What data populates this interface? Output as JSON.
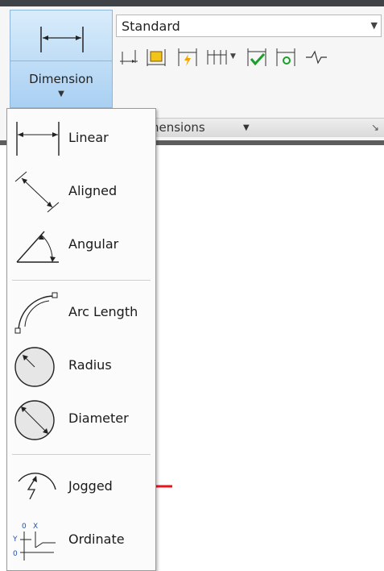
{
  "ribbon": {
    "big_button_label": "Dimension",
    "style_value": "Standard",
    "panel_title": "nensions",
    "tools": [
      "continue-dim-icon",
      "quick-dim-icon",
      "dim-update-icon",
      "baseline-dim-icon",
      "dim-inspect-icon",
      "dim-reassociate-icon",
      "jog-line-icon"
    ]
  },
  "menu": {
    "items": [
      {
        "label": "Linear",
        "icon": "linear-dim-icon"
      },
      {
        "label": "Aligned",
        "icon": "aligned-dim-icon"
      },
      {
        "label": "Angular",
        "icon": "angular-dim-icon"
      },
      {
        "label": "Arc Length",
        "icon": "arc-length-dim-icon"
      },
      {
        "label": "Radius",
        "icon": "radius-dim-icon"
      },
      {
        "label": "Diameter",
        "icon": "diameter-dim-icon"
      },
      {
        "label": "Jogged",
        "icon": "jogged-dim-icon"
      },
      {
        "label": "Ordinate",
        "icon": "ordinate-dim-icon"
      }
    ]
  },
  "annotation": {
    "arrow_color": "#e8141b",
    "points_to": "Jogged"
  }
}
